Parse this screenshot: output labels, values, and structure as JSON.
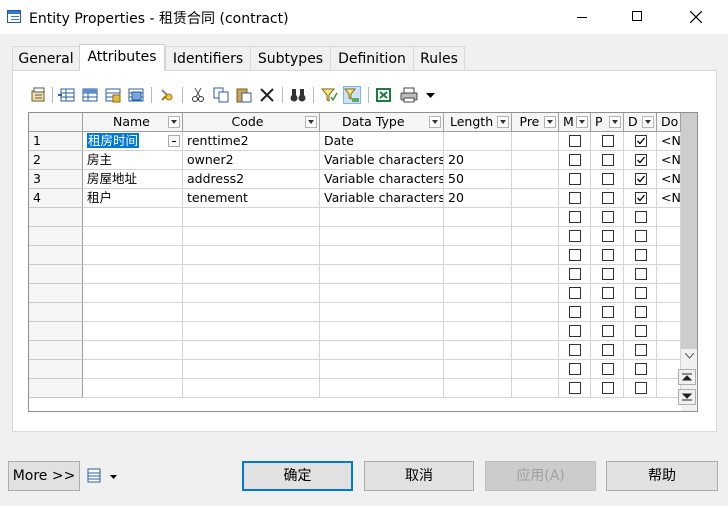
{
  "window": {
    "title": "Entity Properties - 租赁合同 (contract)",
    "icon": "entity-properties-icon"
  },
  "tabs": [
    {
      "label": "General",
      "active": false
    },
    {
      "label": "Attributes",
      "active": true
    },
    {
      "label": "Identifiers",
      "active": false
    },
    {
      "label": "Subtypes",
      "active": false
    },
    {
      "label": "Definition",
      "active": false
    },
    {
      "label": "Rules",
      "active": false
    }
  ],
  "toolbar": {
    "icons": [
      "properties-icon",
      "insert-row-icon",
      "add-row-icon",
      "add-attributes-icon",
      "reuse-attributes-icon",
      "find-icon",
      "cut-icon",
      "copy-icon",
      "paste-icon",
      "delete-icon",
      "find-binoculars-icon",
      "filter-icon",
      "customize-columns-icon",
      "export-excel-icon",
      "print-icon",
      "dropdown-arrow-icon"
    ]
  },
  "grid": {
    "columns": [
      "Name",
      "Code",
      "Data Type",
      "Length",
      "Pre",
      "M",
      "P",
      "D",
      "Do"
    ],
    "rows": [
      {
        "num": "1",
        "name": "租房时间",
        "code": "renttime2",
        "data_type": "Date",
        "length": "",
        "m": false,
        "p": false,
        "d": true,
        "domain": "<N"
      },
      {
        "num": "2",
        "name": "房主",
        "code": "owner2",
        "data_type": "Variable characters",
        "length": "20",
        "m": false,
        "p": false,
        "d": true,
        "domain": "<N"
      },
      {
        "num": "3",
        "name": "房屋地址",
        "code": "address2",
        "data_type": "Variable characters",
        "length": "50",
        "m": false,
        "p": false,
        "d": true,
        "domain": "<N"
      },
      {
        "num": "4",
        "name": "租户",
        "code": "tenement",
        "data_type": "Variable characters",
        "length": "20",
        "m": false,
        "p": false,
        "d": true,
        "domain": "<N"
      }
    ],
    "empty_rows": 10,
    "selected_row": 1
  },
  "nav_buttons": [
    "move-top-icon",
    "move-page-up-icon",
    "move-up-icon",
    "move-down-icon",
    "move-page-down-icon",
    "move-bottom-icon"
  ],
  "buttons": {
    "more": "More >>",
    "ok": "确定",
    "cancel": "取消",
    "apply": "应用(A)",
    "help": "帮助"
  },
  "colors": {
    "selection": "#0078d7",
    "default_button_border": "#0078d7"
  }
}
